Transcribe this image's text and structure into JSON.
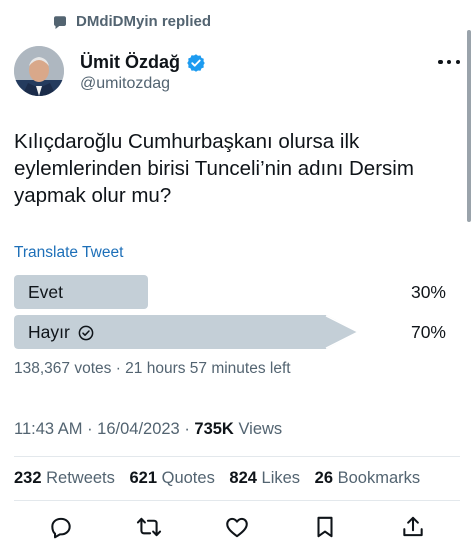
{
  "context": {
    "text": "DMdiDMyin replied",
    "icon": "chat-bubble-icon"
  },
  "author": {
    "name": "Ümit Özdağ",
    "handle": "@umitozdag",
    "verified": true,
    "verified_color": "#1d9bf0"
  },
  "tweet": {
    "text": "Kılıçdaroğlu Cumhurbaşkanı olursa ilk eylemlerinden birisi Tunceli’nin adını Dersim yapmak olur mu?",
    "translate_label": "Translate Tweet"
  },
  "poll": {
    "options": [
      {
        "label": "Evet",
        "percent": "30%",
        "fraction": 0.3,
        "selected": false
      },
      {
        "label": "Hayır",
        "percent": "70%",
        "fraction": 0.7,
        "selected": true
      }
    ],
    "meta": "138,367 votes · 21 hours 57 minutes left",
    "bar_color": "#c4cfd7"
  },
  "timestamp": {
    "time_date": "11:43 AM · 16/04/2023 · ",
    "views_count": "735K",
    "views_label": " Views"
  },
  "stats": {
    "retweets_count": "232",
    "retweets_label": " Retweets",
    "quotes_count": "621",
    "quotes_label": " Quotes",
    "likes_count": "824",
    "likes_label": " Likes",
    "bookmarks_count": "26",
    "bookmarks_label": " Bookmarks"
  },
  "actions": [
    "reply-icon",
    "retweet-icon",
    "like-icon",
    "bookmark-icon",
    "share-icon"
  ],
  "colors": {
    "text": "#0f1419",
    "secondary": "#536471",
    "link": "#1d6fb8"
  }
}
